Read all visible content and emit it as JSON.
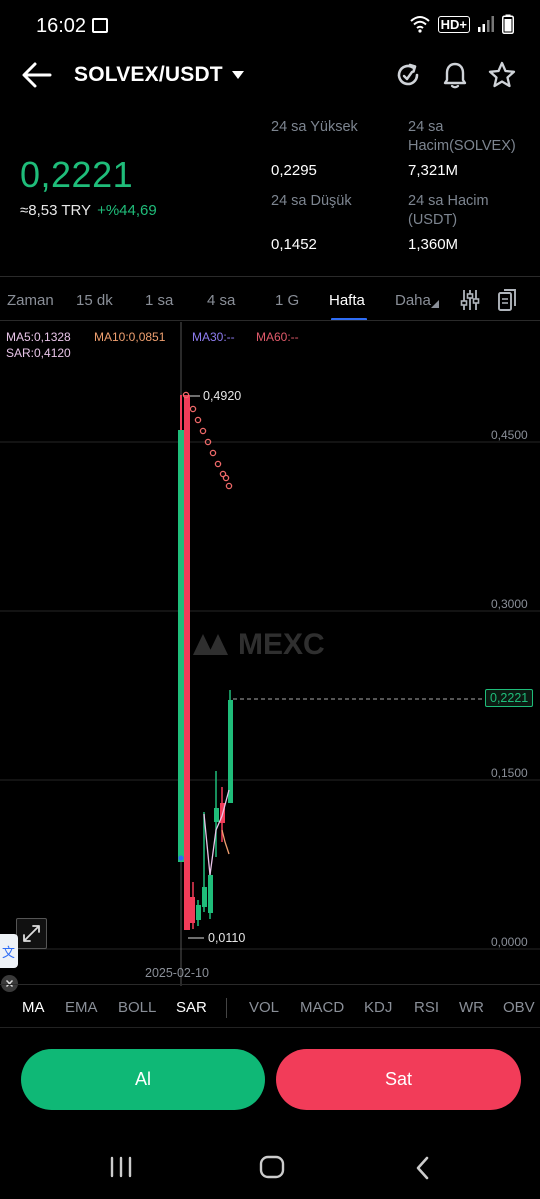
{
  "status": {
    "time": "16:02",
    "network": "HD+"
  },
  "header": {
    "pair": "SOLVEX/USDT"
  },
  "ticker": {
    "last_price": "0,2221",
    "fiat_equiv": "≈8,53 TRY",
    "change": "+%44,69",
    "stats": {
      "high_label": "24 sa Yüksek",
      "high_value": "0,2295",
      "low_label": "24 sa Düşük",
      "low_value": "0,1452",
      "vol_base_label_1": "24 sa",
      "vol_base_label_2": "Hacim(SOLVEX)",
      "vol_base_value": "7,321M",
      "vol_quote_label_1": "24 sa Hacim",
      "vol_quote_label_2": "(USDT)",
      "vol_quote_value": "1,360M"
    }
  },
  "timeframes": [
    {
      "label": "Zaman",
      "active": false
    },
    {
      "label": "15 dk",
      "active": false
    },
    {
      "label": "1 sa",
      "active": false
    },
    {
      "label": "4 sa",
      "active": false
    },
    {
      "label": "1 G",
      "active": false
    },
    {
      "label": "Hafta",
      "active": true
    },
    {
      "label": "Daha",
      "active": false
    }
  ],
  "chart": {
    "ma5": "MA5:0,1328",
    "ma10": "MA10:0,0851",
    "ma30": "MA30:--",
    "ma60": "MA60:--",
    "sar": "SAR:0,4120",
    "high_marker": "0,4920",
    "low_marker": "0,0110",
    "price_tag": "0,2221",
    "watermark": "MEXC",
    "date_label": "2025-02-10",
    "axis_ticks": [
      "0,4500",
      "0,3000",
      "0,1500",
      "0,0000"
    ],
    "colors": {
      "up": "#1fbd7a",
      "down": "#f23c59",
      "ma5": "#e8c4e8",
      "ma10": "#f0a070",
      "ma30": "#8e7cf0",
      "ma60": "#e05a6a",
      "sar": "#f06a6a"
    }
  },
  "indicators": [
    {
      "label": "MA",
      "active": true
    },
    {
      "label": "EMA",
      "active": false
    },
    {
      "label": "BOLL",
      "active": false
    },
    {
      "label": "SAR",
      "active": true
    },
    {
      "label": "VOL",
      "active": false
    },
    {
      "label": "MACD",
      "active": false
    },
    {
      "label": "KDJ",
      "active": false
    },
    {
      "label": "RSI",
      "active": false
    },
    {
      "label": "WR",
      "active": false
    },
    {
      "label": "OBV",
      "active": false
    }
  ],
  "actions": {
    "buy": "Al",
    "sell": "Sat"
  },
  "icons": {
    "back": "arrow-left-icon",
    "refresh": "refresh-icon",
    "alert": "bell-icon",
    "favorite": "star-icon",
    "settings": "sliders-icon",
    "copy": "copy-icon",
    "expand": "expand-icon"
  }
}
